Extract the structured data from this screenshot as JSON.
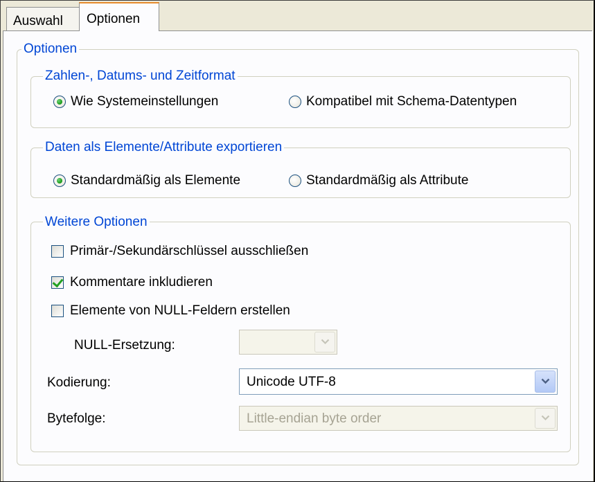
{
  "tabs": [
    {
      "label": "Auswahl",
      "active": false
    },
    {
      "label": "Optionen",
      "active": true
    }
  ],
  "options_group": {
    "legend": "Optionen"
  },
  "number_format": {
    "legend": "Zahlen-, Datums- und Zeitformat",
    "options": [
      {
        "label": "Wie Systemeinstellungen",
        "selected": true
      },
      {
        "label": "Kompatibel mit Schema-Datentypen",
        "selected": false
      }
    ]
  },
  "export": {
    "legend": "Daten als Elemente/Attribute exportieren",
    "options": [
      {
        "label": "Standardmäßig als Elemente",
        "selected": true
      },
      {
        "label": "Standardmäßig als Attribute",
        "selected": false
      }
    ]
  },
  "more": {
    "legend": "Weitere Optionen",
    "checkboxes": [
      {
        "label": "Primär-/Sekundärschlüssel ausschließen",
        "checked": false
      },
      {
        "label": "Kommentare inkludieren",
        "checked": true
      },
      {
        "label": "Elemente von NULL-Feldern erstellen",
        "checked": false
      }
    ],
    "null_replacement": {
      "label": "NULL-Ersetzung:",
      "value": "",
      "enabled": false
    },
    "encoding": {
      "label": "Kodierung:",
      "value": "Unicode UTF-8",
      "enabled": true
    },
    "byte_order": {
      "label": "Bytefolge:",
      "value": "Little-endian byte order",
      "enabled": false
    }
  },
  "colors": {
    "legend": "#0046d5",
    "active_tab_accent": "#e68b2c",
    "check": "#21a121"
  }
}
